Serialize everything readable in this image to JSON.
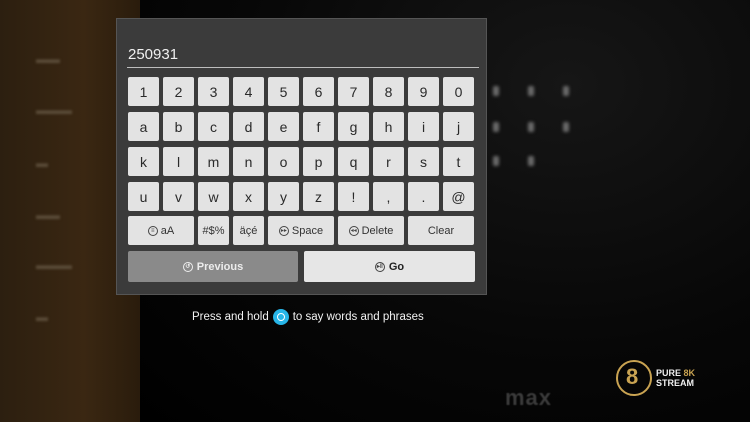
{
  "input": {
    "value": "250931"
  },
  "keyboard": {
    "rows": [
      [
        "1",
        "2",
        "3",
        "4",
        "5",
        "6",
        "7",
        "8",
        "9",
        "0"
      ],
      [
        "a",
        "b",
        "c",
        "d",
        "e",
        "f",
        "g",
        "h",
        "i",
        "j"
      ],
      [
        "k",
        "l",
        "m",
        "n",
        "o",
        "p",
        "q",
        "r",
        "s",
        "t"
      ],
      [
        "u",
        "v",
        "w",
        "x",
        "y",
        "z",
        "!",
        ",",
        ".",
        "@"
      ]
    ],
    "function_keys": {
      "case": "aA",
      "symbols": "#$%",
      "accents": "äçé",
      "space": "Space",
      "delete": "Delete",
      "clear": "Clear"
    },
    "previous_label": "Previous",
    "go_label": "Go"
  },
  "hint": {
    "before": "Press and hold",
    "after": "to say words and phrases"
  },
  "logo": {
    "line1a": "PURE ",
    "line1b": "8K",
    "line2": "STREAM"
  },
  "background": {
    "watermark": "max"
  },
  "colors": {
    "panel": "#3b3b3b",
    "key": "#e3e3e3",
    "alexa": "#27b5e8",
    "logo_gold": "#c9a352"
  }
}
